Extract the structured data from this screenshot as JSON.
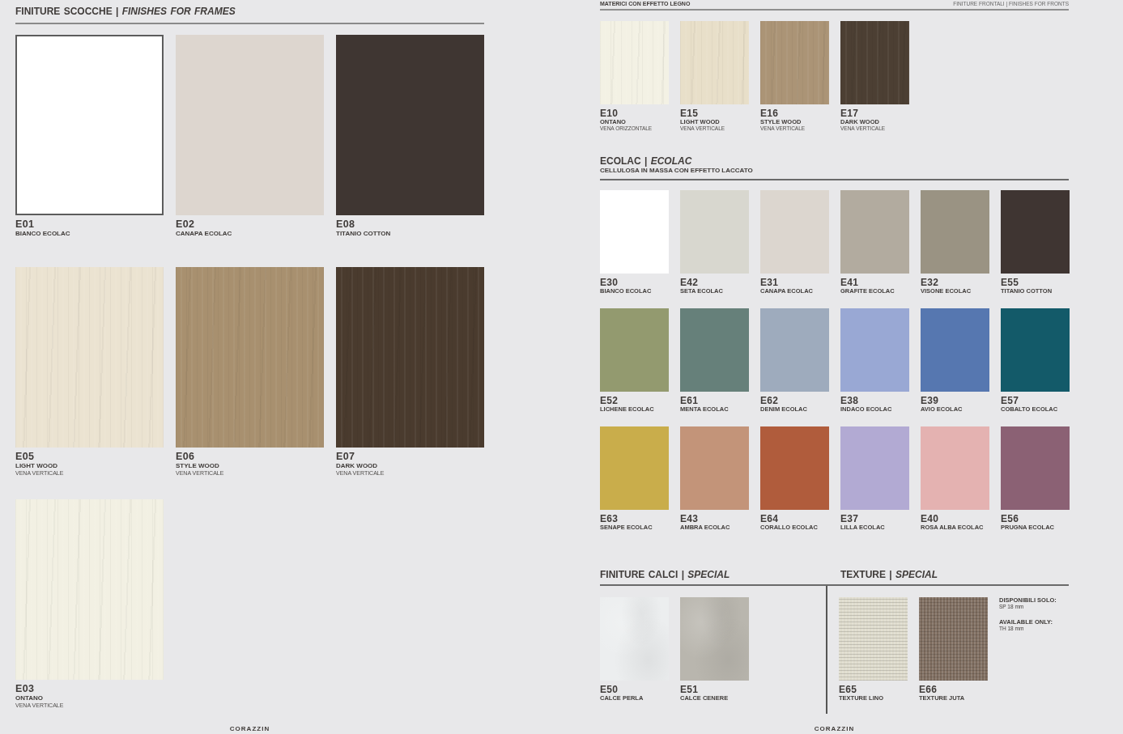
{
  "frames_page": {
    "heading": "FINITURE SCOCCHE | *FINISHES FOR FRAMES*",
    "swatches": [
      {
        "code": "E01",
        "name": "BIANCO ECOLAC",
        "kind": "solid",
        "color": "#ffffff",
        "outlined": true
      },
      {
        "code": "E02",
        "name": "CANAPA ECOLAC",
        "kind": "solid",
        "color": "#ddd6cf",
        "outlined": false
      },
      {
        "code": "E08",
        "name": "TITANIO COTTON",
        "kind": "solid",
        "color": "#3f3632",
        "outlined": false
      },
      {
        "code": "E05",
        "name": "LIGHT WOOD",
        "note": "VENA VERTICALE",
        "kind": "wood",
        "color": "#ebe3d1",
        "outlined": false
      },
      {
        "code": "E06",
        "name": "STYLE WOOD",
        "note": "VENA VERTICALE",
        "kind": "wood",
        "color": "#a8906f",
        "outlined": false
      },
      {
        "code": "E07",
        "name": "DARK WOOD",
        "note": "VENA VERTICALE",
        "kind": "wood",
        "color": "#4a3b2e",
        "outlined": false
      },
      {
        "code": "E03",
        "name": "ONTANO",
        "note": "VENA VERTICALE",
        "kind": "wood",
        "color": "#f2f0e3",
        "outlined": false
      }
    ],
    "footer": "CORAZZIN"
  },
  "fronts_page": {
    "top_heading": "MATERICI CON EFFETTO LEGNO",
    "top_right": "FINITURE FRONTALI | FINISHES FOR FRONTS",
    "wood": [
      {
        "code": "E10",
        "name": "ONTANO",
        "note": "VENA ORIZZONTALE",
        "kind": "wood",
        "color": "#f3f1e4"
      },
      {
        "code": "E15",
        "name": "LIGHT WOOD",
        "note": "VENA VERTICALE",
        "kind": "wood",
        "color": "#e8dfc9"
      },
      {
        "code": "E16",
        "name": "STYLE WOOD",
        "note": "VENA VERTICALE",
        "kind": "wood",
        "color": "#ab9476"
      },
      {
        "code": "E17",
        "name": "DARK WOOD",
        "note": "VENA VERTICALE",
        "kind": "wood",
        "color": "#4c3f33"
      }
    ],
    "ecolac": {
      "heading": "ECOLAC | *ECOLAC*",
      "subtitle": "CELLULOSA IN MASSA CON EFFETTO LACCATO",
      "swatches": [
        {
          "code": "E30",
          "name": "BIANCO ECOLAC",
          "kind": "solid",
          "color": "#ffffff"
        },
        {
          "code": "E42",
          "name": "SETA ECOLAC",
          "kind": "solid",
          "color": "#d8d7cf"
        },
        {
          "code": "E31",
          "name": "CANAPA ECOLAC",
          "kind": "solid",
          "color": "#dcd6cf"
        },
        {
          "code": "E41",
          "name": "GRAFITE ECOLAC",
          "kind": "solid",
          "color": "#b2ab9f"
        },
        {
          "code": "E32",
          "name": "VISONE ECOLAC",
          "kind": "solid",
          "color": "#9a9383"
        },
        {
          "code": "E55",
          "name": "TITANIO COTTON",
          "kind": "solid",
          "color": "#3f3532"
        },
        {
          "code": "E52",
          "name": "LICHENE ECOLAC",
          "kind": "solid",
          "color": "#939a6f"
        },
        {
          "code": "E61",
          "name": "MENTA ECOLAC",
          "kind": "solid",
          "color": "#66807a"
        },
        {
          "code": "E62",
          "name": "DENIM ECOLAC",
          "kind": "solid",
          "color": "#9eabbd"
        },
        {
          "code": "E38",
          "name": "INDACO ECOLAC",
          "kind": "solid",
          "color": "#99a8d4"
        },
        {
          "code": "E39",
          "name": "AVIO ECOLAC",
          "kind": "solid",
          "color": "#5677b0"
        },
        {
          "code": "E57",
          "name": "COBALTO ECOLAC",
          "kind": "solid",
          "color": "#135a69"
        },
        {
          "code": "E63",
          "name": "SENAPE ECOLAC",
          "kind": "solid",
          "color": "#c9ad4b"
        },
        {
          "code": "E43",
          "name": "AMBRA ECOLAC",
          "kind": "solid",
          "color": "#c39479"
        },
        {
          "code": "E64",
          "name": "CORALLO ECOLAC",
          "kind": "solid",
          "color": "#b05c3c"
        },
        {
          "code": "E37",
          "name": "LILLA ECOLAC",
          "kind": "solid",
          "color": "#b2aad3"
        },
        {
          "code": "E40",
          "name": "ROSA ALBA ECOLAC",
          "kind": "solid",
          "color": "#e4b2b1"
        },
        {
          "code": "E56",
          "name": "PRUGNA ECOLAC",
          "kind": "solid",
          "color": "#8b6174"
        }
      ]
    },
    "calci": {
      "heading": "FINITURE CALCI | *SPECIAL*",
      "swatches": [
        {
          "code": "E50",
          "name": "CALCE PERLA",
          "kind": "stone",
          "color": "#eceeef"
        },
        {
          "code": "E51",
          "name": "CALCE CENERE",
          "kind": "stone",
          "color": "#b9b6ae"
        }
      ]
    },
    "texture": {
      "heading": "TEXTURE | *SPECIAL*",
      "swatches": [
        {
          "code": "E65",
          "name": "TEXTURE LINO",
          "kind": "fabric",
          "color": "#dedbcc"
        },
        {
          "code": "E66",
          "name": "TEXTURE JUTA",
          "kind": "fabric",
          "color": "#7d6b5d"
        }
      ],
      "notes": [
        {
          "label": "DISPONIBILI SOLO:",
          "value": "SP 18 mm"
        },
        {
          "label": "AVAILABLE ONLY:",
          "value": "TH 18 mm"
        }
      ]
    },
    "footer": "CORAZZIN"
  }
}
